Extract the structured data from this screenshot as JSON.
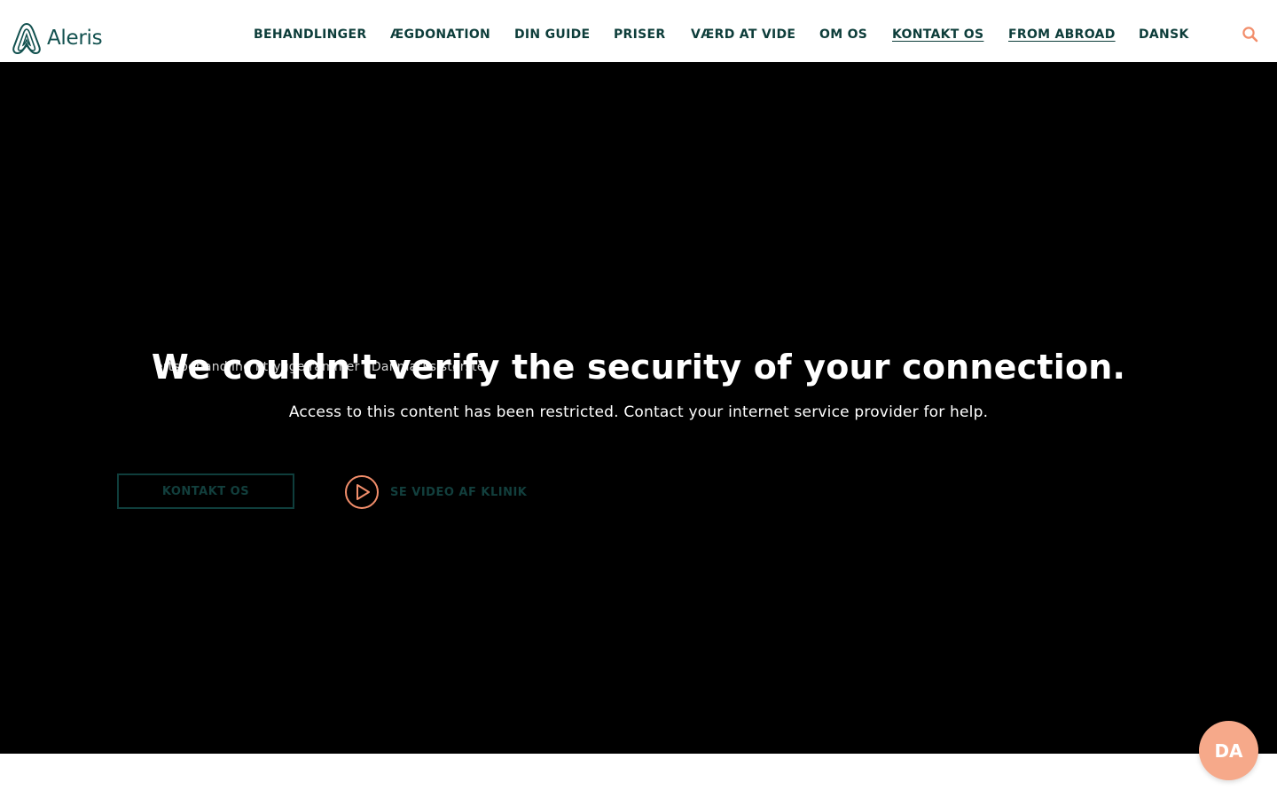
{
  "brand": {
    "name": "Aleris",
    "logo_icon": "aleris-logo-icon",
    "color": "#12514f"
  },
  "nav": {
    "items": [
      {
        "label": "BEHANDLINGER"
      },
      {
        "label": "ÆGDONATION"
      },
      {
        "label": "DIN GUIDE"
      },
      {
        "label": "PRISER"
      },
      {
        "label": "VÆRD AT VIDE"
      },
      {
        "label": "OM OS"
      },
      {
        "label": "KONTAKT OS"
      },
      {
        "label": "FROM ABROAD"
      },
      {
        "label": "DANSK"
      }
    ],
    "search_icon": "search-icon",
    "search_color": "#f28e6b"
  },
  "hero": {
    "background": "#000000",
    "ghost_text": "ertsbehandling i trygge rammer i Danmarks største",
    "error_title": "We couldn't verify the security of your connection.",
    "error_message": "Access to this content has been restricted. Contact your internet service provider for help.",
    "contact_button": "KONTAKT OS",
    "video_link": "SE VIDEO AF KLINIK",
    "video_icon": "play-circle-icon",
    "accent_color": "#f28e6b"
  },
  "language_badge": {
    "label": "DA",
    "color": "#f6a98a"
  }
}
